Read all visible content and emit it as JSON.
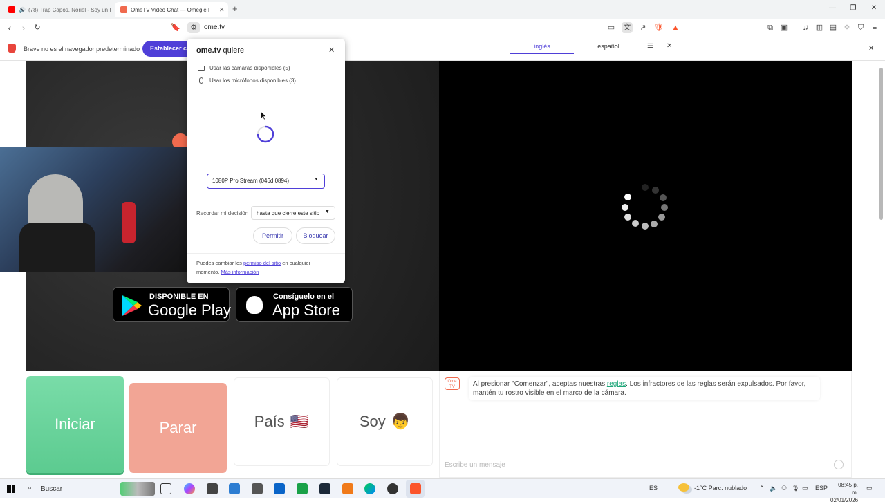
{
  "tabs": [
    {
      "title": "(78) Trap Capos, Noriel - Soy un I",
      "favicon_color": "#ff0000",
      "active": false
    },
    {
      "title": "OmeTV Video Chat — Omegle I",
      "favicon_color": "#f06a4e",
      "active": true
    }
  ],
  "new_tab_label": "+",
  "address_bar": {
    "url": "ome.tv"
  },
  "infobar": {
    "message": "Brave no es el navegador predeterminado",
    "button_label": "Establecer co"
  },
  "translate_bar": {
    "tab_source": "inglés",
    "tab_target": "español"
  },
  "permission_prompt": {
    "site": "ome.tv",
    "title_suffix": "quiere",
    "camera_text": "Usar las cámaras disponibles (5)",
    "mic_text": "Usar los micrófonos disponibles (3)",
    "camera_select_value": "1080P Pro Stream (046d:0894)",
    "remember_label": "Recordar mi decisión",
    "remember_select_value": "hasta que cierre este sitio",
    "allow_label": "Permitir",
    "block_label": "Bloquear",
    "footer_text_1": "Puedes cambiar los",
    "footer_link_1": "permiso del sitio",
    "footer_text_2": "en cualquier momento.",
    "footer_link_2": "Más información"
  },
  "store_badges": {
    "google_small": "DISPONIBLE EN",
    "google_big": "Google Play",
    "apple_small": "Consíguelo en el",
    "apple_big": "App Store"
  },
  "controls": {
    "start_label": "Iniciar",
    "stop_label": "Parar",
    "country_label": "País",
    "country_flag": "🇺🇸",
    "gender_label": "Soy",
    "gender_emoji": "👦"
  },
  "chat": {
    "logo_text": "Ome TV",
    "notice_before": "Al presionar \"Comenzar\", aceptas nuestras",
    "notice_link": "reglas",
    "notice_after": ". Los infractores de las reglas serán expulsados. Por favor, mantén tu rostro visible en el marco de la cámara.",
    "input_placeholder": "Escribe un mensaje"
  },
  "taskbar": {
    "search_placeholder": "Buscar",
    "lang": "ES",
    "weather": "-1°C  Parc. nublado",
    "keyboard": "ESP",
    "time": "08:45 p. m.",
    "date": "02/01/2026"
  },
  "colors": {
    "accent": "#4f3fd8",
    "start_green": "#66d39a",
    "stop_salmon": "#f2a595",
    "link_green": "#1fa77a"
  }
}
